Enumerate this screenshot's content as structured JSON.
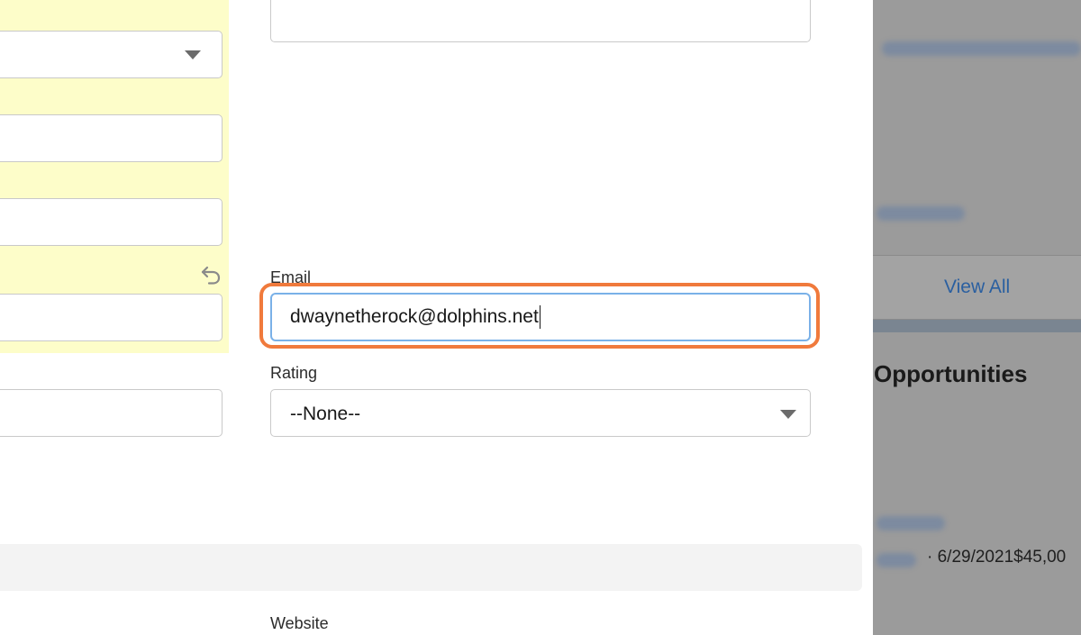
{
  "form": {
    "email": {
      "label": "Email",
      "value": "dwaynetherock@dolphins.net"
    },
    "rating": {
      "label": "Rating",
      "selected": "--None--"
    },
    "website": {
      "label": "Website"
    }
  },
  "background_page": {
    "view_all_label": "View All",
    "opportunities_heading": "Opportunities",
    "opportunity_meta": "· 6/29/2021$45,00"
  },
  "icons": {
    "undo": "undo-icon",
    "dropdown": "chevron-down-icon"
  },
  "colors": {
    "edited_field_background": "#fdfdc9",
    "focus_highlight": "#f07a3c",
    "input_focus_border": "#7ab1e8",
    "link": "#2a5fa0"
  }
}
